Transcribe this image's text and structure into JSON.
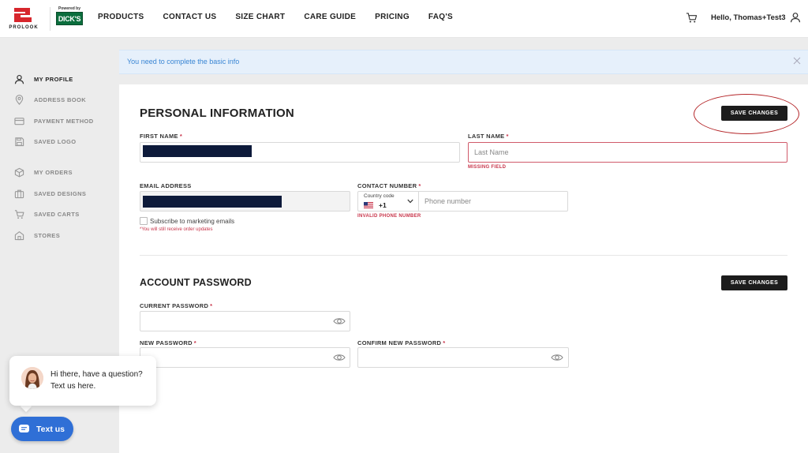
{
  "header": {
    "logo_text": "PROLOOK",
    "powered_by": "Powered by",
    "partner_logo": "DICK'S",
    "nav": [
      "PRODUCTS",
      "CONTACT US",
      "SIZE CHART",
      "CARE GUIDE",
      "PRICING",
      "FAQ'S"
    ],
    "greeting": "Hello, Thomas+Test3"
  },
  "sidebar": {
    "items": [
      {
        "label": "MY PROFILE",
        "icon": "user-icon",
        "active": true
      },
      {
        "label": "ADDRESS BOOK",
        "icon": "location-pin-icon",
        "active": false
      },
      {
        "label": "PAYMENT METHOD",
        "icon": "credit-card-icon",
        "active": false
      },
      {
        "label": "SAVED LOGO",
        "icon": "save-icon",
        "active": false
      },
      {
        "label": "MY ORDERS",
        "icon": "box-icon",
        "active": false
      },
      {
        "label": "SAVED DESIGNS",
        "icon": "briefcase-icon",
        "active": false
      },
      {
        "label": "SAVED CARTS",
        "icon": "cart-icon",
        "active": false
      },
      {
        "label": "STORES",
        "icon": "store-icon",
        "active": false
      }
    ]
  },
  "alert": {
    "message": "You need to complete the basic info"
  },
  "personal": {
    "title": "PERSONAL INFORMATION",
    "save_label": "SAVE CHANGES",
    "first_name_label": "FIRST NAME",
    "last_name_label": "LAST NAME",
    "last_name_placeholder": "Last Name",
    "last_name_error": "MISSING FIELD",
    "email_label": "EMAIL ADDRESS",
    "contact_label": "CONTACT NUMBER",
    "country_code_label": "Country code",
    "country_code_value": "+1",
    "phone_placeholder": "Phone number",
    "phone_error": "INVALID PHONE NUMBER",
    "subscribe_label": "Subscribe to marketing emails",
    "subscribe_note": "*You will still receive order updates",
    "required_mark": "*"
  },
  "password": {
    "title": "ACCOUNT PASSWORD",
    "save_label": "SAVE CHANGES",
    "current_label": "CURRENT PASSWORD",
    "new_label": "NEW PASSWORD",
    "confirm_label": "CONFIRM NEW PASSWORD"
  },
  "chat": {
    "message": "Hi there, have a question? Text us here.",
    "button_label": "Text us"
  },
  "colors": {
    "accent_dark": "#1c1c1c",
    "error": "#c8344a",
    "alert_bg": "#e6f0fb",
    "alert_text": "#3a86d4",
    "chat_button": "#2f6fd6",
    "logo_red": "#d7262c"
  }
}
